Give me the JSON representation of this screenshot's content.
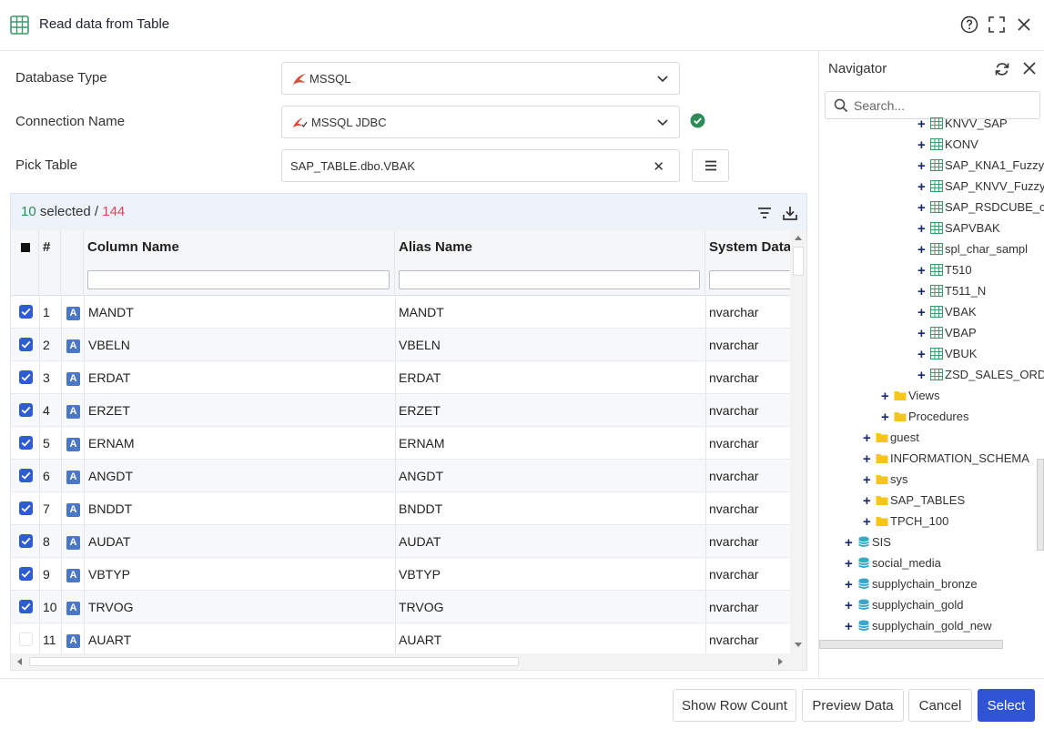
{
  "dialog": {
    "title": "Read data from Table",
    "icons": {
      "title": "table-grid-icon",
      "help": "help-circle-icon",
      "maximize": "maximize-icon",
      "close": "close-icon"
    }
  },
  "form": {
    "database_type": {
      "label": "Database Type",
      "value": "MSSQL",
      "icon": "mssql-icon"
    },
    "connection_name": {
      "label": "Connection Name",
      "value": "MSSQL JDBC",
      "icon": "mssql-connection-icon",
      "status": "connected"
    },
    "pick_table": {
      "label": "Pick Table",
      "value": "SAP_TABLE.dbo.VBAK"
    }
  },
  "grid": {
    "selected": "10",
    "separator": " selected / ",
    "total": "144",
    "columns": {
      "num": "#",
      "column_name": "Column Name",
      "alias_name": "Alias Name",
      "system_data": "System Data"
    },
    "rows": [
      {
        "checked": true,
        "num": "1",
        "type": "A",
        "column": "MANDT",
        "alias": "MANDT",
        "sys": "nvarchar"
      },
      {
        "checked": true,
        "num": "2",
        "type": "A",
        "column": "VBELN",
        "alias": "VBELN",
        "sys": "nvarchar"
      },
      {
        "checked": true,
        "num": "3",
        "type": "A",
        "column": "ERDAT",
        "alias": "ERDAT",
        "sys": "nvarchar"
      },
      {
        "checked": true,
        "num": "4",
        "type": "A",
        "column": "ERZET",
        "alias": "ERZET",
        "sys": "nvarchar"
      },
      {
        "checked": true,
        "num": "5",
        "type": "A",
        "column": "ERNAM",
        "alias": "ERNAM",
        "sys": "nvarchar"
      },
      {
        "checked": true,
        "num": "6",
        "type": "A",
        "column": "ANGDT",
        "alias": "ANGDT",
        "sys": "nvarchar"
      },
      {
        "checked": true,
        "num": "7",
        "type": "A",
        "column": "BNDDT",
        "alias": "BNDDT",
        "sys": "nvarchar"
      },
      {
        "checked": true,
        "num": "8",
        "type": "A",
        "column": "AUDAT",
        "alias": "AUDAT",
        "sys": "nvarchar"
      },
      {
        "checked": true,
        "num": "9",
        "type": "A",
        "column": "VBTYP",
        "alias": "VBTYP",
        "sys": "nvarchar"
      },
      {
        "checked": true,
        "num": "10",
        "type": "A",
        "column": "TRVOG",
        "alias": "TRVOG",
        "sys": "nvarchar"
      },
      {
        "checked": false,
        "num": "11",
        "type": "A",
        "column": "AUART",
        "alias": "AUART",
        "sys": "nvarchar"
      }
    ]
  },
  "navigator": {
    "title": "Navigator",
    "search_placeholder": "Search...",
    "items": [
      {
        "label": "KNVV_SAP",
        "kind": "table",
        "level": 4
      },
      {
        "label": "KONV",
        "kind": "table",
        "level": 4
      },
      {
        "label": "SAP_KNA1_Fuzzy",
        "kind": "table",
        "level": 4
      },
      {
        "label": "SAP_KNVV_Fuzzy",
        "kind": "table",
        "level": 4
      },
      {
        "label": "SAP_RSDCUBE_c",
        "kind": "table",
        "level": 4
      },
      {
        "label": "SAPVBAK",
        "kind": "table",
        "level": 4
      },
      {
        "label": "spl_char_sampl",
        "kind": "table",
        "level": 4
      },
      {
        "label": "T510",
        "kind": "table",
        "level": 4
      },
      {
        "label": "T511_N",
        "kind": "table",
        "level": 4
      },
      {
        "label": "VBAK",
        "kind": "table",
        "level": 4
      },
      {
        "label": "VBAP",
        "kind": "table",
        "level": 4
      },
      {
        "label": "VBUK",
        "kind": "table",
        "level": 4
      },
      {
        "label": "ZSD_SALES_ORD",
        "kind": "table",
        "level": 4
      },
      {
        "label": "Views",
        "kind": "folder",
        "level": 3
      },
      {
        "label": "Procedures",
        "kind": "folder",
        "level": 3
      },
      {
        "label": "guest",
        "kind": "folder",
        "level": 2
      },
      {
        "label": "INFORMATION_SCHEMA",
        "kind": "folder",
        "level": 2
      },
      {
        "label": "sys",
        "kind": "folder",
        "level": 2
      },
      {
        "label": "SAP_TABLES",
        "kind": "folder",
        "level": 2
      },
      {
        "label": "TPCH_100",
        "kind": "folder",
        "level": 2
      },
      {
        "label": "SIS",
        "kind": "database",
        "level": 1
      },
      {
        "label": "social_media",
        "kind": "database",
        "level": 1
      },
      {
        "label": "supplychain_bronze",
        "kind": "database",
        "level": 1
      },
      {
        "label": "supplychain_gold",
        "kind": "database",
        "level": 1
      },
      {
        "label": "supplychain_gold_new",
        "kind": "database",
        "level": 1
      }
    ]
  },
  "footer": {
    "show_row_count": "Show Row Count",
    "preview_data": "Preview Data",
    "cancel": "Cancel",
    "select": "Select"
  },
  "colors": {
    "primary": "#2f55d4",
    "selected_count": "#2e8b57",
    "total_count": "#e0435a",
    "checkbox": "#2f5bd3",
    "type_badge": "#4a78c4",
    "folder": "#f5c518",
    "table_icon": "#3d9a6a",
    "database_icon": "#3aa7c9"
  }
}
